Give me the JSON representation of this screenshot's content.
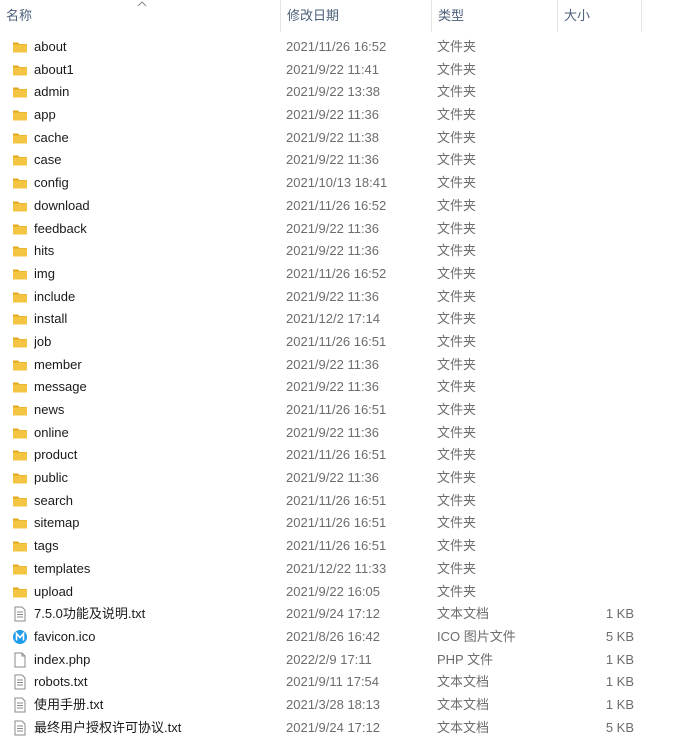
{
  "columns": {
    "name": "名称",
    "date": "修改日期",
    "type": "类型",
    "size": "大小"
  },
  "icons": {
    "folder": "folder-icon",
    "text": "text-file-icon",
    "ico": "ico-file-icon",
    "php": "php-file-icon",
    "sort": "sort-ascending-icon"
  },
  "colors": {
    "folder": "#f4c542",
    "folder_dark": "#e0a91c",
    "header_text": "#4c607a",
    "ico_blue": "#1e9be9"
  },
  "files": [
    {
      "name": "about",
      "date": "2021/11/26 16:52",
      "type": "文件夹",
      "size": "",
      "icon": "folder"
    },
    {
      "name": "about1",
      "date": "2021/9/22 11:41",
      "type": "文件夹",
      "size": "",
      "icon": "folder"
    },
    {
      "name": "admin",
      "date": "2021/9/22 13:38",
      "type": "文件夹",
      "size": "",
      "icon": "folder"
    },
    {
      "name": "app",
      "date": "2021/9/22 11:36",
      "type": "文件夹",
      "size": "",
      "icon": "folder"
    },
    {
      "name": "cache",
      "date": "2021/9/22 11:38",
      "type": "文件夹",
      "size": "",
      "icon": "folder"
    },
    {
      "name": "case",
      "date": "2021/9/22 11:36",
      "type": "文件夹",
      "size": "",
      "icon": "folder"
    },
    {
      "name": "config",
      "date": "2021/10/13 18:41",
      "type": "文件夹",
      "size": "",
      "icon": "folder"
    },
    {
      "name": "download",
      "date": "2021/11/26 16:52",
      "type": "文件夹",
      "size": "",
      "icon": "folder"
    },
    {
      "name": "feedback",
      "date": "2021/9/22 11:36",
      "type": "文件夹",
      "size": "",
      "icon": "folder"
    },
    {
      "name": "hits",
      "date": "2021/9/22 11:36",
      "type": "文件夹",
      "size": "",
      "icon": "folder"
    },
    {
      "name": "img",
      "date": "2021/11/26 16:52",
      "type": "文件夹",
      "size": "",
      "icon": "folder"
    },
    {
      "name": "include",
      "date": "2021/9/22 11:36",
      "type": "文件夹",
      "size": "",
      "icon": "folder"
    },
    {
      "name": "install",
      "date": "2021/12/2 17:14",
      "type": "文件夹",
      "size": "",
      "icon": "folder"
    },
    {
      "name": "job",
      "date": "2021/11/26 16:51",
      "type": "文件夹",
      "size": "",
      "icon": "folder"
    },
    {
      "name": "member",
      "date": "2021/9/22 11:36",
      "type": "文件夹",
      "size": "",
      "icon": "folder"
    },
    {
      "name": "message",
      "date": "2021/9/22 11:36",
      "type": "文件夹",
      "size": "",
      "icon": "folder"
    },
    {
      "name": "news",
      "date": "2021/11/26 16:51",
      "type": "文件夹",
      "size": "",
      "icon": "folder"
    },
    {
      "name": "online",
      "date": "2021/9/22 11:36",
      "type": "文件夹",
      "size": "",
      "icon": "folder"
    },
    {
      "name": "product",
      "date": "2021/11/26 16:51",
      "type": "文件夹",
      "size": "",
      "icon": "folder"
    },
    {
      "name": "public",
      "date": "2021/9/22 11:36",
      "type": "文件夹",
      "size": "",
      "icon": "folder"
    },
    {
      "name": "search",
      "date": "2021/11/26 16:51",
      "type": "文件夹",
      "size": "",
      "icon": "folder"
    },
    {
      "name": "sitemap",
      "date": "2021/11/26 16:51",
      "type": "文件夹",
      "size": "",
      "icon": "folder"
    },
    {
      "name": "tags",
      "date": "2021/11/26 16:51",
      "type": "文件夹",
      "size": "",
      "icon": "folder"
    },
    {
      "name": "templates",
      "date": "2021/12/22 11:33",
      "type": "文件夹",
      "size": "",
      "icon": "folder"
    },
    {
      "name": "upload",
      "date": "2021/9/22 16:05",
      "type": "文件夹",
      "size": "",
      "icon": "folder"
    },
    {
      "name": "7.5.0功能及说明.txt",
      "date": "2021/9/24 17:12",
      "type": "文本文档",
      "size": "1 KB",
      "icon": "text"
    },
    {
      "name": "favicon.ico",
      "date": "2021/8/26 16:42",
      "type": "ICO 图片文件",
      "size": "5 KB",
      "icon": "ico"
    },
    {
      "name": "index.php",
      "date": "2022/2/9 17:11",
      "type": "PHP 文件",
      "size": "1 KB",
      "icon": "php"
    },
    {
      "name": "robots.txt",
      "date": "2021/9/11 17:54",
      "type": "文本文档",
      "size": "1 KB",
      "icon": "text"
    },
    {
      "name": "使用手册.txt",
      "date": "2021/3/28 18:13",
      "type": "文本文档",
      "size": "1 KB",
      "icon": "text"
    },
    {
      "name": "最终用户授权许可协议.txt",
      "date": "2021/9/24 17:12",
      "type": "文本文档",
      "size": "5 KB",
      "icon": "text"
    }
  ]
}
